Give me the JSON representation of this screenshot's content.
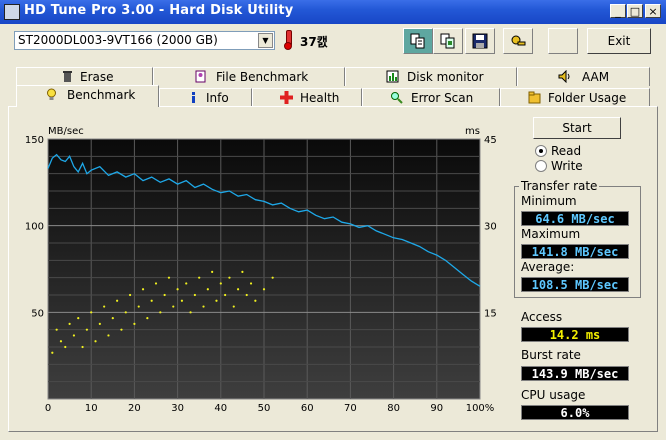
{
  "window": {
    "title": "HD Tune Pro 3.00 - Hard Disk Utility",
    "minimize": "_",
    "maximize": "□",
    "close": "×"
  },
  "toolbar": {
    "drive": "ST2000DL003-9VT166 (2000 GB)",
    "temperature": "37캜",
    "exit_label": "Exit",
    "buttons": [
      "copy-info-icon",
      "copy-screenshot-icon",
      "save-icon",
      "options-icon",
      "blank"
    ]
  },
  "tabs": {
    "row1": [
      {
        "label": "Erase",
        "icon": "trash-icon"
      },
      {
        "label": "File Benchmark",
        "icon": "file-benchmark-icon"
      },
      {
        "label": "Disk monitor",
        "icon": "monitor-icon"
      },
      {
        "label": "AAM",
        "icon": "speaker-icon"
      }
    ],
    "row2": [
      {
        "label": "Benchmark",
        "icon": "lightbulb-icon",
        "selected": true
      },
      {
        "label": "Info",
        "icon": "info-icon"
      },
      {
        "label": "Health",
        "icon": "health-cross-icon"
      },
      {
        "label": "Error Scan",
        "icon": "magnifier-icon"
      },
      {
        "label": "Folder Usage",
        "icon": "folder-icon"
      }
    ]
  },
  "controls": {
    "start_label": "Start",
    "read_label": "Read",
    "write_label": "Write",
    "mode": "Read"
  },
  "results": {
    "transfer_title": "Transfer rate",
    "minimum_label": "Minimum",
    "minimum_value": "64.6 MB/sec",
    "maximum_label": "Maximum",
    "maximum_value": "141.8 MB/sec",
    "average_label": "Average:",
    "average_value": "108.5 MB/sec",
    "access_label": "Access",
    "access_value": "14.2 ms",
    "burst_label": "Burst rate",
    "burst_value": "143.9 MB/sec",
    "cpu_label": "CPU usage",
    "cpu_value": "6.0%"
  },
  "colors": {
    "transfer_line": "#1ea8e8",
    "access_points": "#f0f020",
    "chart_bg_top": "#0a0a0a",
    "chart_bg_bottom": "#3c3c3c",
    "grid": "#5a5a5a"
  },
  "chart_data": {
    "type": "line",
    "ylabel": "MB/sec",
    "y2label": "ms",
    "ylim": [
      0,
      150
    ],
    "y2lim": [
      0,
      45
    ],
    "yticks": [
      50,
      100,
      150
    ],
    "y2ticks": [
      15,
      30,
      45
    ],
    "xticks": [
      "0",
      "10",
      "20",
      "30",
      "40",
      "50",
      "60",
      "70",
      "80",
      "90",
      "100%"
    ],
    "series": [
      {
        "name": "Transfer rate",
        "x": [
          0,
          1,
          2,
          3,
          4,
          5,
          6,
          7,
          8,
          9,
          10,
          12,
          14,
          16,
          18,
          20,
          22,
          24,
          26,
          28,
          30,
          32,
          34,
          36,
          38,
          40,
          42,
          44,
          46,
          48,
          50,
          52,
          54,
          56,
          58,
          60,
          62,
          64,
          66,
          68,
          70,
          72,
          74,
          76,
          78,
          80,
          82,
          84,
          86,
          88,
          90,
          92,
          94,
          96,
          98,
          100
        ],
        "y": [
          133,
          139,
          141,
          138,
          137,
          140,
          134,
          131,
          136,
          130,
          132,
          134,
          129,
          131,
          128,
          130,
          126,
          128,
          125,
          127,
          124,
          126,
          122,
          124,
          121,
          119,
          120,
          117,
          118,
          115,
          114,
          112,
          113,
          110,
          108,
          109,
          106,
          104,
          105,
          102,
          101,
          99,
          100,
          97,
          95,
          93,
          92,
          90,
          88,
          85,
          83,
          80,
          76,
          72,
          68,
          65
        ]
      }
    ],
    "access_time_points": [
      [
        1,
        8
      ],
      [
        2,
        12
      ],
      [
        3,
        10
      ],
      [
        4,
        9
      ],
      [
        5,
        13
      ],
      [
        6,
        11
      ],
      [
        7,
        14
      ],
      [
        8,
        9
      ],
      [
        9,
        12
      ],
      [
        10,
        15
      ],
      [
        11,
        10
      ],
      [
        12,
        13
      ],
      [
        13,
        16
      ],
      [
        14,
        11
      ],
      [
        15,
        14
      ],
      [
        16,
        17
      ],
      [
        17,
        12
      ],
      [
        18,
        15
      ],
      [
        19,
        18
      ],
      [
        20,
        13
      ],
      [
        21,
        16
      ],
      [
        22,
        19
      ],
      [
        23,
        14
      ],
      [
        24,
        17
      ],
      [
        25,
        20
      ],
      [
        26,
        15
      ],
      [
        27,
        18
      ],
      [
        28,
        21
      ],
      [
        29,
        16
      ],
      [
        30,
        19
      ],
      [
        31,
        17
      ],
      [
        32,
        20
      ],
      [
        33,
        15
      ],
      [
        34,
        18
      ],
      [
        35,
        21
      ],
      [
        36,
        16
      ],
      [
        37,
        19
      ],
      [
        38,
        22
      ],
      [
        39,
        17
      ],
      [
        40,
        20
      ],
      [
        41,
        18
      ],
      [
        42,
        21
      ],
      [
        43,
        16
      ],
      [
        44,
        19
      ],
      [
        45,
        22
      ],
      [
        46,
        18
      ],
      [
        47,
        20
      ],
      [
        48,
        17
      ],
      [
        50,
        19
      ],
      [
        52,
        21
      ]
    ]
  }
}
